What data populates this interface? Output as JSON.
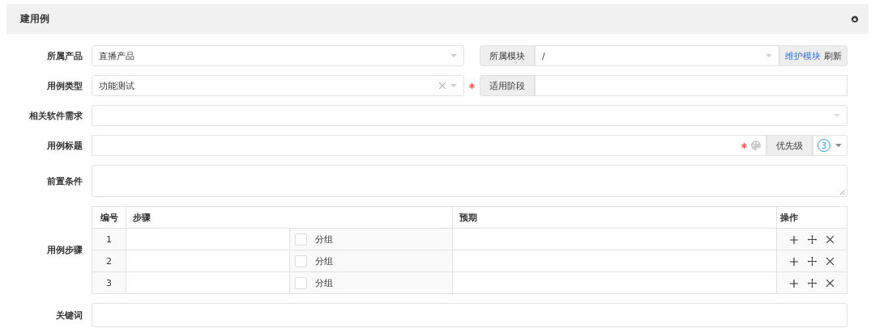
{
  "panel": {
    "title": "建用例"
  },
  "product": {
    "label": "所属产品",
    "value": "直播产品"
  },
  "module": {
    "label": "所属模块",
    "value": "/",
    "link": "维护模块",
    "action": "刷新"
  },
  "case_type": {
    "label": "用例类型",
    "value": "功能测试",
    "required": true
  },
  "stage": {
    "label": "适用阶段"
  },
  "requirement": {
    "label": "相关软件需求"
  },
  "case_title": {
    "label": "用例标题",
    "required": true,
    "priority_label": "优先级",
    "priority": "3"
  },
  "precondition": {
    "label": "前置条件"
  },
  "steps": {
    "label": "用例步骤",
    "columns": [
      "编号",
      "步骤",
      "预期",
      "操作"
    ],
    "rows": [
      {
        "number": "1",
        "group_label": "分组",
        "checked": false
      },
      {
        "number": "2",
        "group_label": "分组",
        "checked": false
      },
      {
        "number": "3",
        "group_label": "分组",
        "checked": false
      }
    ]
  },
  "keywords": {
    "label": "关键词"
  }
}
